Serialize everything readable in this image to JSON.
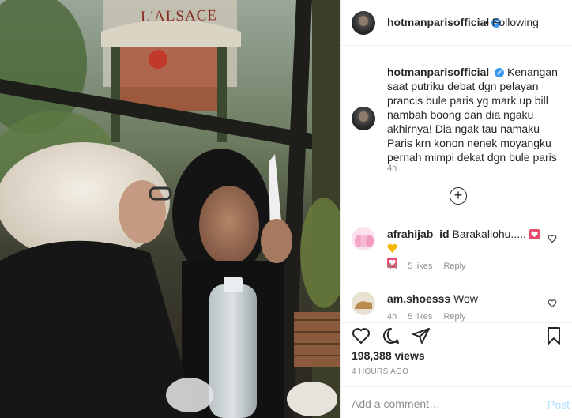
{
  "post": {
    "header": {
      "username": "hotmanparisofficial",
      "verified_mark": "✔",
      "separator": "•",
      "follow_label": "Following"
    },
    "caption": {
      "username": "hotmanparisofficial",
      "text": "Kenangan saat putriku debat dgn pelayan prancis bule paris yg mark up bill nambah boong dan dia ngaku akhirnya! Dia ngak tau namaku Paris krn konon nenek moyangku pernah mimpi dekat dgn bule paris",
      "time": "4h"
    },
    "load_more_icon": "plus-circle-icon",
    "comments": [
      {
        "username": "afrahijab_id",
        "text": "Barakallohu.....",
        "emojis": [
          "heart-box-emoji",
          "yellow-heart-emoji",
          "heart-box-emoji"
        ],
        "time": "4h",
        "likes": "5 likes",
        "reply": "Reply"
      },
      {
        "username": "am.shoesss",
        "text": "Wow",
        "time": "4h",
        "likes": "5 likes",
        "reply": "Reply"
      }
    ],
    "actions": {
      "icons": [
        "heart-icon",
        "comment-icon",
        "share-icon",
        "bookmark-icon"
      ]
    },
    "likes": "198,388 views",
    "posted": "4 HOURS AGO",
    "add_comment": {
      "placeholder": "Add a comment…",
      "post_label": "Post"
    },
    "photo": {
      "sign_text": "L'ALSACE"
    },
    "colors": {
      "verified": "#3897f0",
      "post_disabled": "#b2dffc",
      "muted": "#8e8e8e"
    }
  }
}
